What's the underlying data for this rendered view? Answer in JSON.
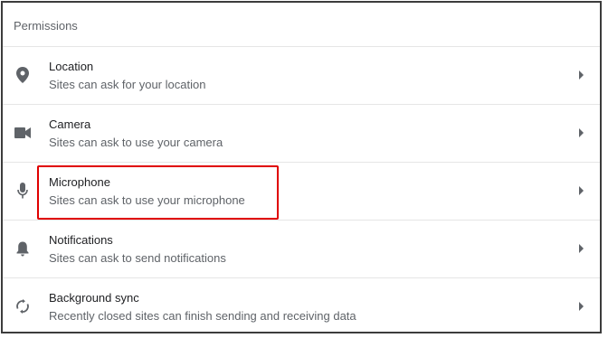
{
  "section": {
    "title": "Permissions"
  },
  "permissions": [
    {
      "label": "Location",
      "description": "Sites can ask for your location",
      "icon": "location-pin-icon"
    },
    {
      "label": "Camera",
      "description": "Sites can ask to use your camera",
      "icon": "camera-icon"
    },
    {
      "label": "Microphone",
      "description": "Sites can ask to use your microphone",
      "icon": "microphone-icon"
    },
    {
      "label": "Notifications",
      "description": "Sites can ask to send notifications",
      "icon": "bell-icon"
    },
    {
      "label": "Background sync",
      "description": "Recently closed sites can finish sending and receiving data",
      "icon": "sync-icon"
    }
  ],
  "highlight": {
    "target": "Microphone",
    "color": "#e00000"
  }
}
